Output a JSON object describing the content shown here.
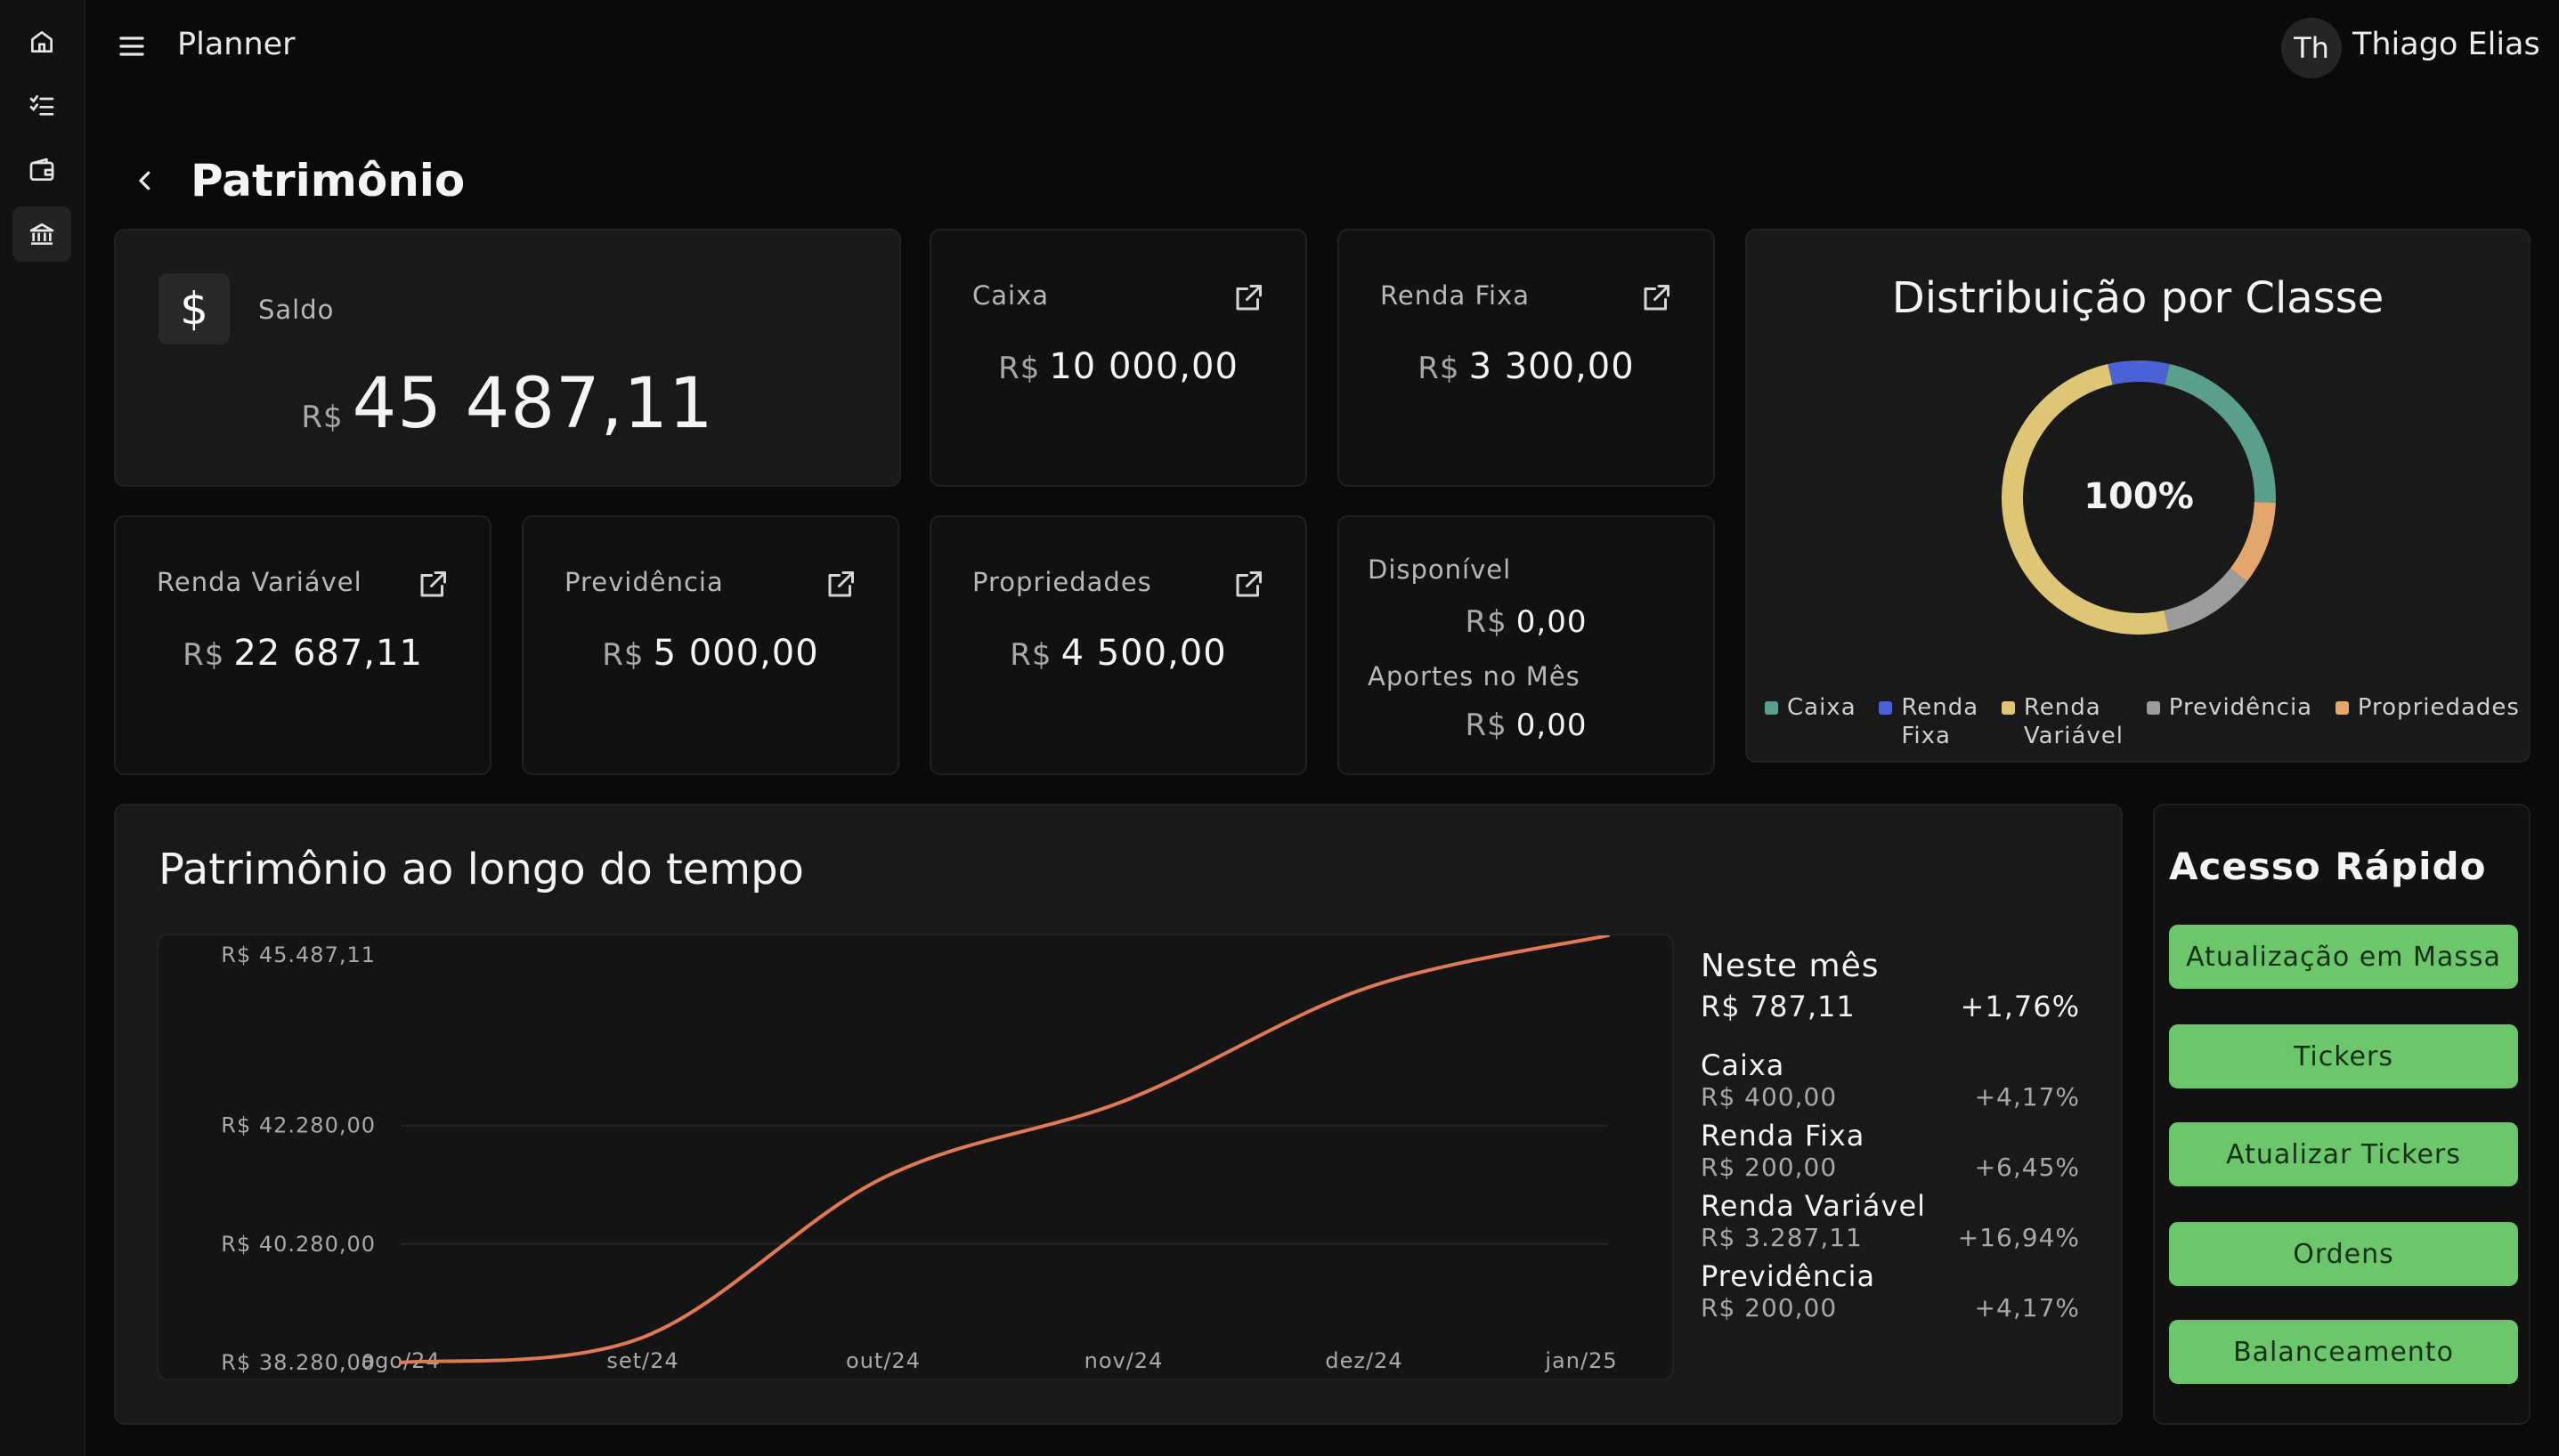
{
  "app": {
    "title": "Planner"
  },
  "user": {
    "initials": "Th",
    "name": "Thiago Elias"
  },
  "page": {
    "title": "Patrimônio"
  },
  "nav": {
    "items": [
      "home-icon",
      "checklist-icon",
      "wallet-icon",
      "bank-icon"
    ],
    "active": "bank-icon"
  },
  "currency": "R$",
  "saldo": {
    "label": "Saldo",
    "value": "45 487,11"
  },
  "cards": {
    "caixa": {
      "label": "Caixa",
      "value": "10 000,00"
    },
    "renda_fixa": {
      "label": "Renda Fixa",
      "value": "3 300,00"
    },
    "renda_variavel": {
      "label": "Renda Variável",
      "value": "22 687,11"
    },
    "previdencia": {
      "label": "Previdência",
      "value": "5 000,00"
    },
    "propriedades": {
      "label": "Propriedades",
      "value": "4 500,00"
    }
  },
  "disponivel": {
    "label": "Disponível",
    "value": "0,00",
    "aportes_label": "Aportes no Mês",
    "aportes_value": "0,00"
  },
  "distribution": {
    "title": "Distribuição por Classe",
    "center_label": "100%",
    "legend": [
      {
        "name": "Caixa",
        "lines": [
          "Caixa"
        ],
        "color": "#5a9e8c",
        "value": 10000.0
      },
      {
        "name": "Renda Fixa",
        "lines": [
          "Renda",
          "Fixa"
        ],
        "color": "#4a62d6",
        "value": 3300.0
      },
      {
        "name": "Renda Variável",
        "lines": [
          "Renda",
          "Variável"
        ],
        "color": "#dfc676",
        "value": 22687.11
      },
      {
        "name": "Previdência",
        "lines": [
          "Previdência"
        ],
        "color": "#9c9c9c",
        "value": 5000.0
      },
      {
        "name": "Propriedades",
        "lines": [
          "Propriedades"
        ],
        "color": "#e3a66c",
        "value": 4500.0
      }
    ]
  },
  "timeline": {
    "title": "Patrimônio ao longo do tempo",
    "y_ticks": [
      "R$ 45.487,11",
      "R$ 42.280,00",
      "R$ 40.280,00",
      "R$ 38.280,00"
    ],
    "x_ticks": [
      "ago/24",
      "set/24",
      "out/24",
      "nov/24",
      "dez/24",
      "jan/25"
    ]
  },
  "chart_data": {
    "type": "line",
    "x": [
      "ago/24",
      "set/24",
      "out/24",
      "nov/24",
      "dez/24",
      "jan/25"
    ],
    "values": [
      38280.0,
      38700.0,
      41400.0,
      42700.0,
      44600.0,
      45487.11
    ],
    "y_tick_values": [
      45487.11,
      42280.0,
      40280.0,
      38280.0
    ],
    "ylim": [
      38280.0,
      45487.11
    ],
    "color": "#e07a52",
    "grid": true
  },
  "month_stats": {
    "title": "Neste mês",
    "value": "R$ 787,11",
    "pct": "+1,76%",
    "items": [
      {
        "name": "Caixa",
        "value": "R$ 400,00",
        "pct": "+4,17%"
      },
      {
        "name": "Renda Fixa",
        "value": "R$ 200,00",
        "pct": "+6,45%"
      },
      {
        "name": "Renda Variável",
        "value": "R$ 3.287,11",
        "pct": "+16,94%"
      },
      {
        "name": "Previdência",
        "value": "R$ 200,00",
        "pct": "+4,17%"
      }
    ]
  },
  "quick_access": {
    "title": "Acesso Rápido",
    "buttons": [
      "Atualização em Massa",
      "Tickers",
      "Atualizar Tickers",
      "Ordens",
      "Balanceamento"
    ]
  }
}
